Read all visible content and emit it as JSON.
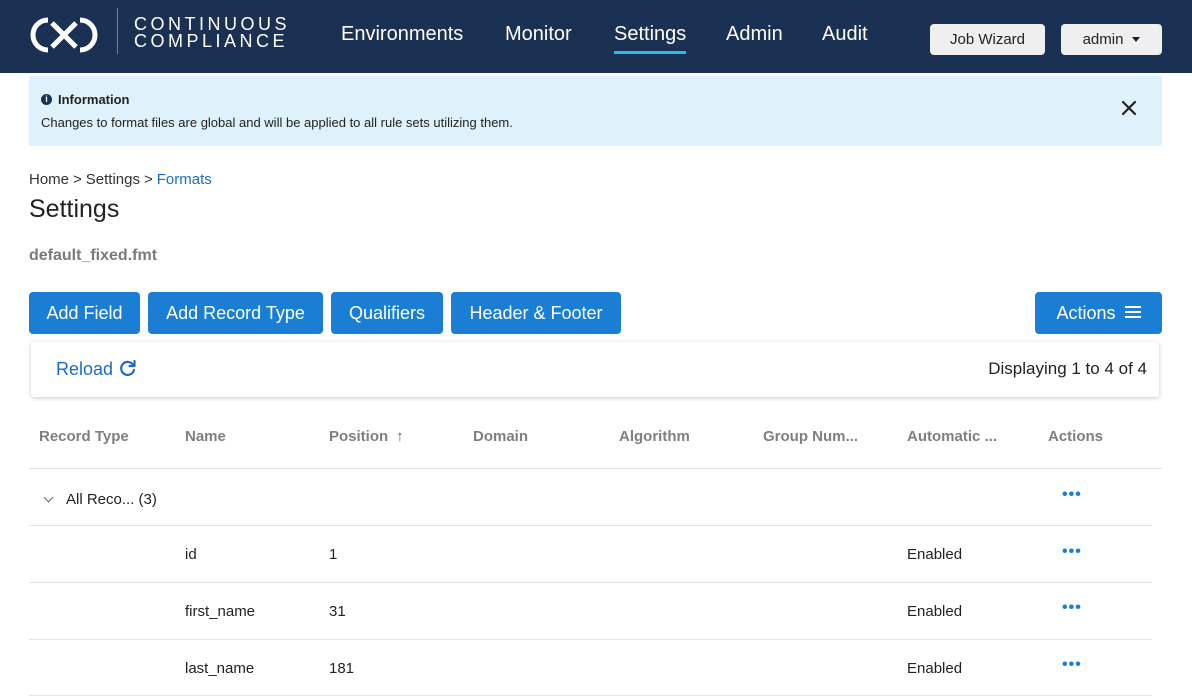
{
  "header": {
    "brand_line1": "CONTINUOUS",
    "brand_line2": "COMPLIANCE",
    "logo_icon": "cx-logo-icon",
    "nav": [
      {
        "label": "Environments",
        "active": false
      },
      {
        "label": "Monitor",
        "active": false
      },
      {
        "label": "Settings",
        "active": true
      },
      {
        "label": "Admin",
        "active": false
      },
      {
        "label": "Audit",
        "active": false
      }
    ],
    "job_wizard_label": "Job Wizard",
    "user_label": "admin"
  },
  "info": {
    "title": "Information",
    "message": "Changes to format files are global and will be applied to all rule sets utilizing them.",
    "icon": "info-circle-icon",
    "close_icon": "close-icon"
  },
  "breadcrumb": {
    "items": [
      "Home",
      "Settings",
      "Formats"
    ],
    "separator": ">"
  },
  "page": {
    "title": "Settings",
    "file_name": "default_fixed.fmt"
  },
  "actions": {
    "add_field": "Add Field",
    "add_record_type": "Add Record Type",
    "qualifiers": "Qualifiers",
    "header_footer": "Header & Footer",
    "actions_menu": "Actions"
  },
  "toolbar": {
    "reload": "Reload",
    "reload_icon": "refresh-icon",
    "display_count": "Displaying 1 to 4 of 4"
  },
  "table": {
    "columns": [
      "Record Type",
      "Name",
      "Position",
      "Domain",
      "Algorithm",
      "Group Num...",
      "Automatic ...",
      "Actions"
    ],
    "sort_column": "Position",
    "sort_direction": "ascending",
    "group": {
      "label": "All Reco...",
      "count": "(3)"
    },
    "rows": [
      {
        "name": "id",
        "position": "1",
        "automatic": "Enabled"
      },
      {
        "name": "first_name",
        "position": "31",
        "automatic": "Enabled"
      },
      {
        "name": "last_name",
        "position": "181",
        "automatic": "Enabled"
      }
    ],
    "row_actions_icon": "more-horizontal-icon",
    "row_actions_glyph": "•••"
  },
  "colors": {
    "nav_bg": "#1b3154",
    "nav_active_underline": "#2db7e5",
    "primary": "#1a7fd4",
    "info_bg": "#dff1fb",
    "link": "#1a6dc5"
  }
}
